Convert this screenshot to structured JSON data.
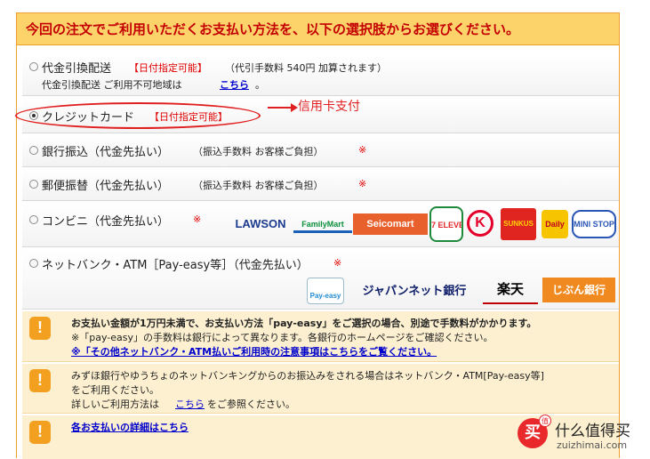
{
  "header": {
    "title": "今回の注文でご利用いただくお支払い方法を、以下の選択肢からお選びください。"
  },
  "options": {
    "cod": {
      "label": "代金引換配送",
      "tag": "【日付指定可能】",
      "fee": "（代引手数料 540円 加算されます）",
      "note": "代金引換配送 ご利用不可地域は",
      "note_link": "こちら",
      "note_end": "。",
      "checked": false
    },
    "credit": {
      "label": "クレジットカード",
      "tag": "【日付指定可能】",
      "checked": true
    },
    "bank": {
      "label": "銀行振込（代金先払い）",
      "fee": "（振込手数料 お客様ご負担）",
      "mark": "※",
      "checked": false
    },
    "postal": {
      "label": "郵便振替（代金先払い）",
      "fee": "（振込手数料 お客様ご負担）",
      "mark": "※",
      "checked": false
    },
    "conv": {
      "label": "コンビニ（代金先払い）",
      "mark": "※",
      "checked": false
    },
    "netbank": {
      "label": "ネットバンク・ATM［Pay-easy等］（代金先払い）",
      "mark": "※",
      "checked": false
    }
  },
  "annotation": {
    "text": "信用卡支付",
    "color": "#e02020"
  },
  "conv_logos": [
    "LAWSON",
    "FamilyMart",
    "Seicomart",
    "7 ELEVEN",
    "K",
    "SUNKUS",
    "Daily",
    "MINI STOP"
  ],
  "bank_logos": [
    "Pay-easy",
    "ジャパンネット銀行",
    "楽天",
    "じぶん銀行"
  ],
  "notes": {
    "n1": {
      "line1": "お支払い金額が1万円未満で、お支払い方法「pay-easy」をご選択の場合、別途で手数料がかかります。",
      "line2": "※「pay-easy」の手数料は銀行によって異なります。各銀行のホームページをご確認ください。",
      "link": "※「その他ネットバンク・ATM払いご利用時の注意事項はこちらをご覧ください。"
    },
    "n2": {
      "line1": "みずほ銀行やゆうちょのネットバンキングからのお振込みをされる場合はネットバンク・ATM[Pay-easy等]",
      "line2": "をご利用ください。",
      "line3_pre": "詳しいご利用方法は",
      "line3_link": "こちら",
      "line3_post": "をご参照ください。"
    },
    "n3": {
      "link": "各お支払いの詳細はこちら"
    }
  },
  "watermark": {
    "cn": "什么值得买",
    "en": "zuizhimai.com",
    "badge": "买",
    "sup": "值"
  },
  "colors": {
    "header_bg": "#fbd36a",
    "accent_red": "#e00000",
    "note_bg": "#fdf0d0",
    "link": "#0000cc"
  }
}
